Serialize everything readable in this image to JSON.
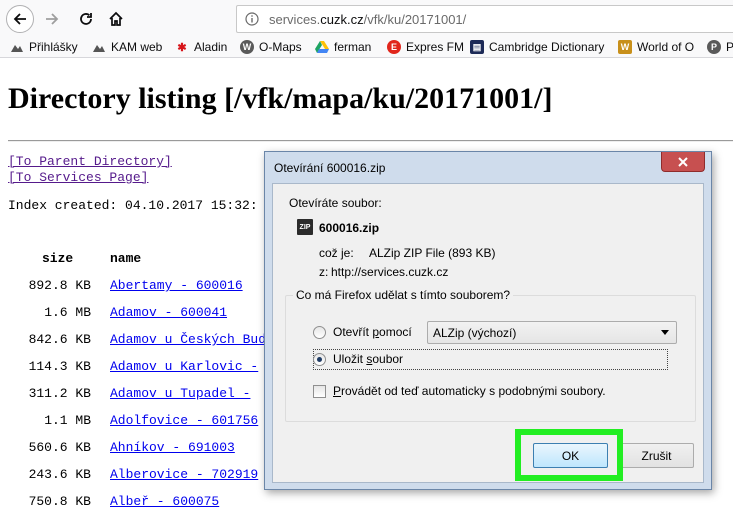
{
  "browser": {
    "url_prefix": "services.",
    "url_host": "cuzk.cz",
    "url_path": "/vfk/ku/20171001/",
    "bookmarks": [
      {
        "label": "Přihlášky",
        "icon": "bookmark-generic-icon",
        "color": "#555555"
      },
      {
        "label": "KAM web",
        "icon": "bookmark-generic-icon",
        "color": "#555555"
      },
      {
        "label": "Aladin",
        "icon": "bookmark-aladin-icon",
        "color": "#d7141a"
      },
      {
        "label": "O-Maps",
        "icon": "wikimapia-icon",
        "color": "#5a5a5a"
      },
      {
        "label": "ferman",
        "icon": "google-drive-icon",
        "color": "#1fa463"
      },
      {
        "label": "Expres FM",
        "icon": "expres-fm-icon",
        "color": "#e1261c"
      },
      {
        "label": "Cambridge Dictionary",
        "icon": "cambridge-icon",
        "color": "#1d2a57"
      },
      {
        "label": "World of O",
        "icon": "world-of-o-icon",
        "color": "#c8901b"
      },
      {
        "label": "P",
        "icon": "pinterest-icon",
        "color": "#5a5a5a"
      }
    ]
  },
  "page": {
    "title": "Directory listing [/vfk/mapa/ku/20171001/]",
    "parent_link": "[To Parent Directory]",
    "services_link": "[To Services Page]",
    "index_created": "Index created: 04.10.2017 15:32:",
    "col_size": "size",
    "col_name": "name",
    "rows": [
      {
        "size": "892.8 KB",
        "name": "Abertamy - 600016"
      },
      {
        "size": "1.6 MB",
        "name": "Adamov - 600041"
      },
      {
        "size": "842.6 KB",
        "name": "Adamov u Českých Bud"
      },
      {
        "size": "114.3 KB",
        "name": "Adamov u Karlovic -"
      },
      {
        "size": "311.2 KB",
        "name": "Adamov u Tupadel - "
      },
      {
        "size": "1.1 MB",
        "name": "Adolfovice - 601756"
      },
      {
        "size": "560.6 KB",
        "name": "Ahníkov - 691003"
      },
      {
        "size": "243.6 KB",
        "name": "Alberovice - 702919"
      },
      {
        "size": "750.8 KB",
        "name": "Albeř - 600075"
      }
    ]
  },
  "dialog": {
    "title": "Otevírání 600016.zip",
    "opening_label": "Otevíráte soubor:",
    "file_name": "600016.zip",
    "file_type_label": "což je:",
    "file_type": "ALZip ZIP File (893 KB)",
    "source_label": "z:",
    "source": "http://services.cuzk.cz",
    "question": "Co má Firefox udělat s tímto souborem?",
    "open_with_pre": "Otevřít",
    "open_with_key": "p",
    "open_with_post": "omocí",
    "open_with_app": "ALZip (výchozí)",
    "save_pre": "Uložit ",
    "save_key": "s",
    "save_post": "oubor",
    "auto_key": "P",
    "auto_post": "rovádět od teď automaticky s podobnými soubory.",
    "ok_label": "OK",
    "cancel_label": "Zrušit",
    "selected_option": "save",
    "highlight_color": "#22ee22"
  }
}
